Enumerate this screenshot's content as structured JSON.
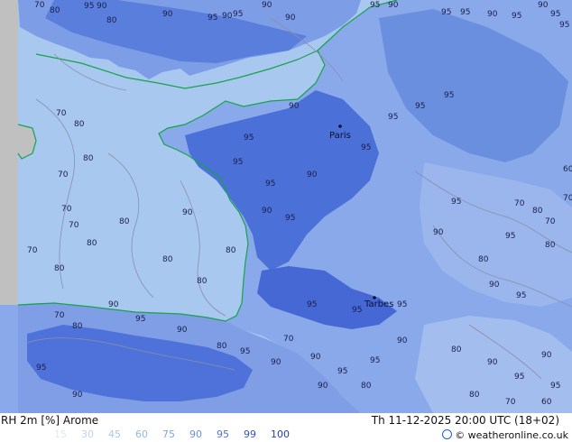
{
  "footer": {
    "title": "RH 2m [%] Arome",
    "valid_time": "Th 11-12-2025 20:00 UTC (18+02)",
    "credit": "© weatheronline.co.uk",
    "credit_icon": "circle-copyright-icon"
  },
  "legend": {
    "values": [
      "15",
      "30",
      "45",
      "60",
      "75",
      "90",
      "95",
      "99",
      "100"
    ],
    "colors": [
      "#dce9f8",
      "#bcd3f2",
      "#a8c8f0",
      "#8fb9ef",
      "#7fa6e8",
      "#6a8fdf",
      "#4f73d7",
      "#3153c7",
      "#1f3fae"
    ]
  },
  "map": {
    "colors": {
      "sea": "#a8c8f0",
      "coast": "#16a34a",
      "rh95": "#6a8fdf",
      "rh99": "#3f66d9",
      "land90": "#8fb0ea",
      "outside_domain": "#c0c0c0",
      "contour": "#8a8fa8"
    },
    "cities": [
      {
        "name": "Paris"
      },
      {
        "name": "Tarbes"
      }
    ],
    "contour_labels": [
      {
        "v": "70"
      },
      {
        "v": "80"
      },
      {
        "v": "95"
      },
      {
        "v": "90"
      },
      {
        "v": "80"
      },
      {
        "v": "90"
      },
      {
        "v": "95"
      },
      {
        "v": "90"
      },
      {
        "v": "95"
      },
      {
        "v": "90"
      },
      {
        "v": "90"
      },
      {
        "v": "95"
      },
      {
        "v": "90"
      },
      {
        "v": "95"
      },
      {
        "v": "95"
      },
      {
        "v": "90"
      },
      {
        "v": "95"
      },
      {
        "v": "90"
      },
      {
        "v": "95"
      },
      {
        "v": "95"
      },
      {
        "v": "70"
      },
      {
        "v": "80"
      },
      {
        "v": "80"
      },
      {
        "v": "70"
      },
      {
        "v": "70"
      },
      {
        "v": "70"
      },
      {
        "v": "80"
      },
      {
        "v": "80"
      },
      {
        "v": "70"
      },
      {
        "v": "80"
      },
      {
        "v": "80"
      },
      {
        "v": "90"
      },
      {
        "v": "80"
      },
      {
        "v": "80"
      },
      {
        "v": "90"
      },
      {
        "v": "95"
      },
      {
        "v": "95"
      },
      {
        "v": "95"
      },
      {
        "v": "95"
      },
      {
        "v": "90"
      },
      {
        "v": "95"
      },
      {
        "v": "95"
      },
      {
        "v": "95"
      },
      {
        "v": "95"
      },
      {
        "v": "90"
      },
      {
        "v": "95"
      },
      {
        "v": "95"
      },
      {
        "v": "95"
      },
      {
        "v": "70"
      },
      {
        "v": "80"
      },
      {
        "v": "70"
      },
      {
        "v": "70"
      },
      {
        "v": "60"
      },
      {
        "v": "80"
      },
      {
        "v": "95"
      },
      {
        "v": "90"
      },
      {
        "v": "95"
      },
      {
        "v": "80"
      },
      {
        "v": "90"
      },
      {
        "v": "95"
      },
      {
        "v": "70"
      },
      {
        "v": "80"
      },
      {
        "v": "90"
      },
      {
        "v": "95"
      },
      {
        "v": "90"
      },
      {
        "v": "80"
      },
      {
        "v": "95"
      },
      {
        "v": "90"
      },
      {
        "v": "70"
      },
      {
        "v": "90"
      },
      {
        "v": "95"
      },
      {
        "v": "90"
      },
      {
        "v": "80"
      },
      {
        "v": "95"
      },
      {
        "v": "90"
      },
      {
        "v": "80"
      },
      {
        "v": "90"
      },
      {
        "v": "95"
      },
      {
        "v": "90"
      },
      {
        "v": "95"
      },
      {
        "v": "80"
      },
      {
        "v": "70"
      },
      {
        "v": "60"
      },
      {
        "v": "95"
      },
      {
        "v": "90"
      }
    ]
  }
}
